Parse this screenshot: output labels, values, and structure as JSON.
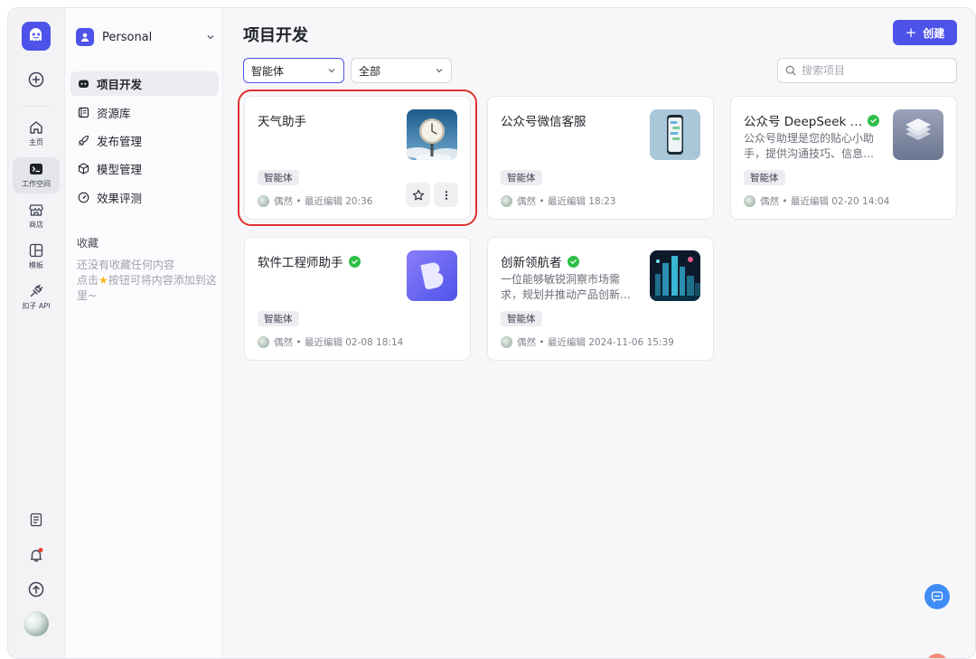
{
  "rail": {
    "items": [
      {
        "label": "主页",
        "icon": "home-icon"
      },
      {
        "label": "工作空间",
        "icon": "terminal-icon"
      },
      {
        "label": "商店",
        "icon": "store-icon"
      },
      {
        "label": "模板",
        "icon": "template-icon"
      },
      {
        "label": "扣子 API",
        "icon": "plug-icon"
      }
    ]
  },
  "sidebar": {
    "workspace": "Personal",
    "nav": [
      {
        "label": "项目开发",
        "icon": "bot-icon"
      },
      {
        "label": "资源库",
        "icon": "library-icon"
      },
      {
        "label": "发布管理",
        "icon": "rocket-icon"
      },
      {
        "label": "模型管理",
        "icon": "cube-icon"
      },
      {
        "label": "效果评测",
        "icon": "gauge-icon"
      }
    ],
    "favorites_title": "收藏",
    "favorites_empty_1": "还没有收藏任何内容",
    "favorites_empty_2a": "点击",
    "favorites_empty_2b": "按钮可将内容添加到这里~"
  },
  "main": {
    "title": "项目开发",
    "create_label": "创建",
    "filter_type": "智能体",
    "filter_scope": "全部",
    "search_placeholder": "搜索项目"
  },
  "cards": [
    {
      "title": "天气助手",
      "desc": "",
      "verified": false,
      "tag": "智能体",
      "author": "偶然",
      "edited": "• 最近编辑 20:36"
    },
    {
      "title": "公众号微信客服",
      "desc": "",
      "verified": false,
      "tag": "智能体",
      "author": "偶然",
      "edited": "• 最近编辑 18:23"
    },
    {
      "title": "公众号 DeepSeek …",
      "desc": "公众号助理是您的贴心小助手，提供沟通技巧、信息…",
      "verified": true,
      "tag": "智能体",
      "author": "偶然",
      "edited": "• 最近编辑 02-20 14:04"
    },
    {
      "title": "软件工程师助手",
      "desc": "",
      "verified": true,
      "tag": "智能体",
      "author": "偶然",
      "edited": "• 最近编辑 02-08 18:14"
    },
    {
      "title": "创新领航者",
      "desc": "一位能够敏锐洞察市场需求，规划并推动产品创新…",
      "verified": true,
      "tag": "智能体",
      "author": "偶然",
      "edited": "• 最近编辑 2024-11-06 15:39"
    }
  ],
  "colors": {
    "accent": "#4d53e8",
    "verified": "#2fbf49",
    "highlight": "#e0312e"
  }
}
